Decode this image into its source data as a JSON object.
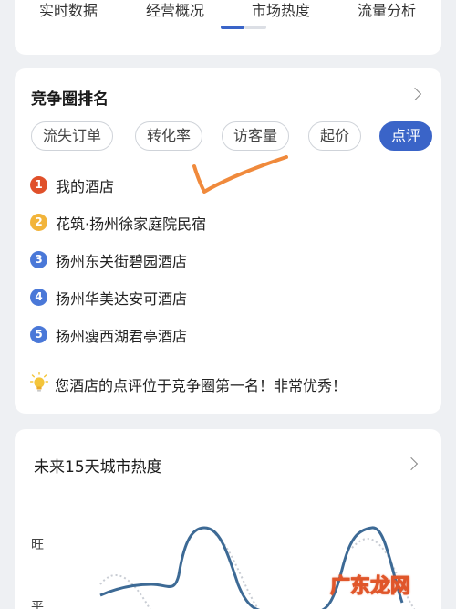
{
  "top_nav": {
    "tabs": [
      {
        "label": "实时数据"
      },
      {
        "label": "经营概况"
      },
      {
        "label": "市场热度"
      },
      {
        "label": "流量分析"
      }
    ]
  },
  "competition": {
    "title": "竞争圈排名",
    "filters": [
      {
        "label": "流失订单",
        "active": false
      },
      {
        "label": "转化率",
        "active": false
      },
      {
        "label": "访客量",
        "active": false
      },
      {
        "label": "起价",
        "active": false
      },
      {
        "label": "点评",
        "active": true
      }
    ],
    "ranking": [
      {
        "rank": "1",
        "name": "我的酒店"
      },
      {
        "rank": "2",
        "name": "花筑·扬州徐家庭院民宿"
      },
      {
        "rank": "3",
        "name": "扬州东关街碧园酒店"
      },
      {
        "rank": "4",
        "name": "扬州华美达安可酒店"
      },
      {
        "rank": "5",
        "name": "扬州瘦西湖君亭酒店"
      }
    ],
    "tip": "您酒店的点评位于竞争圈第一名！非常优秀！"
  },
  "city_heat": {
    "title": "未来15天城市热度",
    "y_labels": [
      "旺",
      "平"
    ]
  },
  "watermark": "广东龙网",
  "colors": {
    "accent": "#3a64c8",
    "rank1": "#e0502a",
    "rank2": "#f2b43a",
    "rank_other": "#4a78d8",
    "annotation_stroke": "#f08a3c",
    "bulb": "#f4c53a"
  }
}
